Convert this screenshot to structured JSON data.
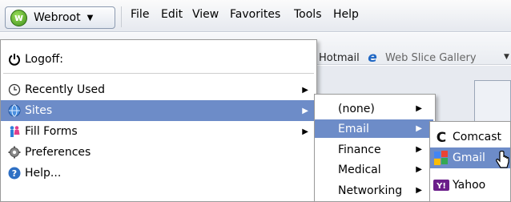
{
  "menubar": {
    "webroot_label": "Webroot",
    "items": [
      "File",
      "Edit",
      "View",
      "Favorites",
      "Tools",
      "Help"
    ]
  },
  "favorites_bar": {
    "hotmail": "Hotmail",
    "web_slice_gallery": "Web Slice Gallery"
  },
  "webroot_menu": {
    "items": [
      {
        "label": "Logoff:",
        "icon": "power-icon"
      },
      {
        "label": "Recently Used",
        "icon": "clock-icon",
        "submenu": true
      },
      {
        "label": "Sites",
        "icon": "globe-icon",
        "submenu": true,
        "selected": true
      },
      {
        "label": "Fill Forms",
        "icon": "people-icon",
        "submenu": true
      },
      {
        "label": "Preferences",
        "icon": "gear-icon"
      },
      {
        "label": "Help...",
        "icon": "help-icon"
      }
    ]
  },
  "sites_menu": {
    "items": [
      {
        "label": "(none)",
        "submenu": true
      },
      {
        "label": "Email",
        "submenu": true,
        "selected": true
      },
      {
        "label": "Finance",
        "submenu": true
      },
      {
        "label": "Medical",
        "submenu": true
      },
      {
        "label": "Networking",
        "submenu": true
      }
    ]
  },
  "email_menu": {
    "items": [
      {
        "label": "Comcast",
        "icon": "comcast-icon"
      },
      {
        "label": "Gmail",
        "icon": "google-icon",
        "selected": true
      },
      {
        "label": "Yahoo",
        "icon": "yahoo-icon"
      }
    ]
  },
  "colors": {
    "selection": "#6d8cc8",
    "webroot_green": "#3f8f1c"
  }
}
